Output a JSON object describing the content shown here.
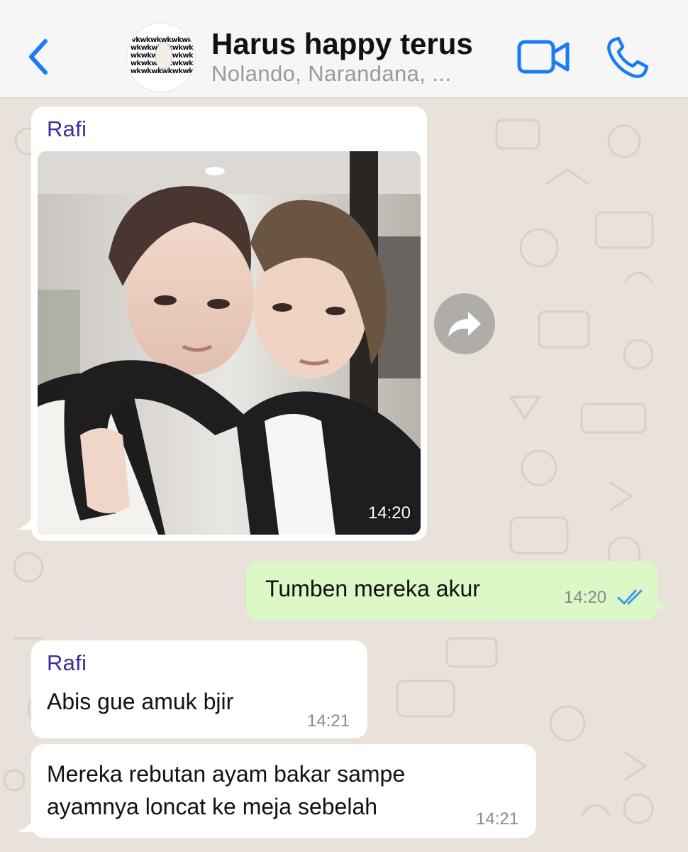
{
  "header": {
    "title": "Harus happy terus",
    "subtitle": "Nolando, Narandana, ...",
    "avatar_text": "vkwkwkwkwkwkwkwkwkwkwkwkwkwkwkwkwkwkwkwkwkwkwkwkwkwkwkwkwkwk",
    "accent_color": "#1a7cf5"
  },
  "messages": [
    {
      "type": "image",
      "direction": "incoming",
      "sender": "Rafi",
      "time": "14:20"
    },
    {
      "type": "text",
      "direction": "outgoing",
      "text": "Tumben mereka akur",
      "time": "14:20",
      "status": "read"
    },
    {
      "type": "text",
      "direction": "incoming",
      "sender": "Rafi",
      "text": "Abis gue amuk bjir",
      "time": "14:21"
    },
    {
      "type": "text",
      "direction": "incoming",
      "lines": [
        "Mereka rebutan ayam bakar sampe",
        "ayamnya loncat ke meja sebelah"
      ],
      "time": "14:21"
    }
  ],
  "colors": {
    "incoming_bubble": "#ffffff",
    "outgoing_bubble": "#dcf8c6",
    "sender_name": "#3a2fa0",
    "read_ticks": "#3a9be8",
    "wallpaper": "#e8e2da"
  },
  "icons": {
    "back": "chevron-left-icon",
    "video": "video-camera-icon",
    "call": "phone-icon",
    "forward": "forward-arrow-icon",
    "ticks": "double-check-icon"
  }
}
